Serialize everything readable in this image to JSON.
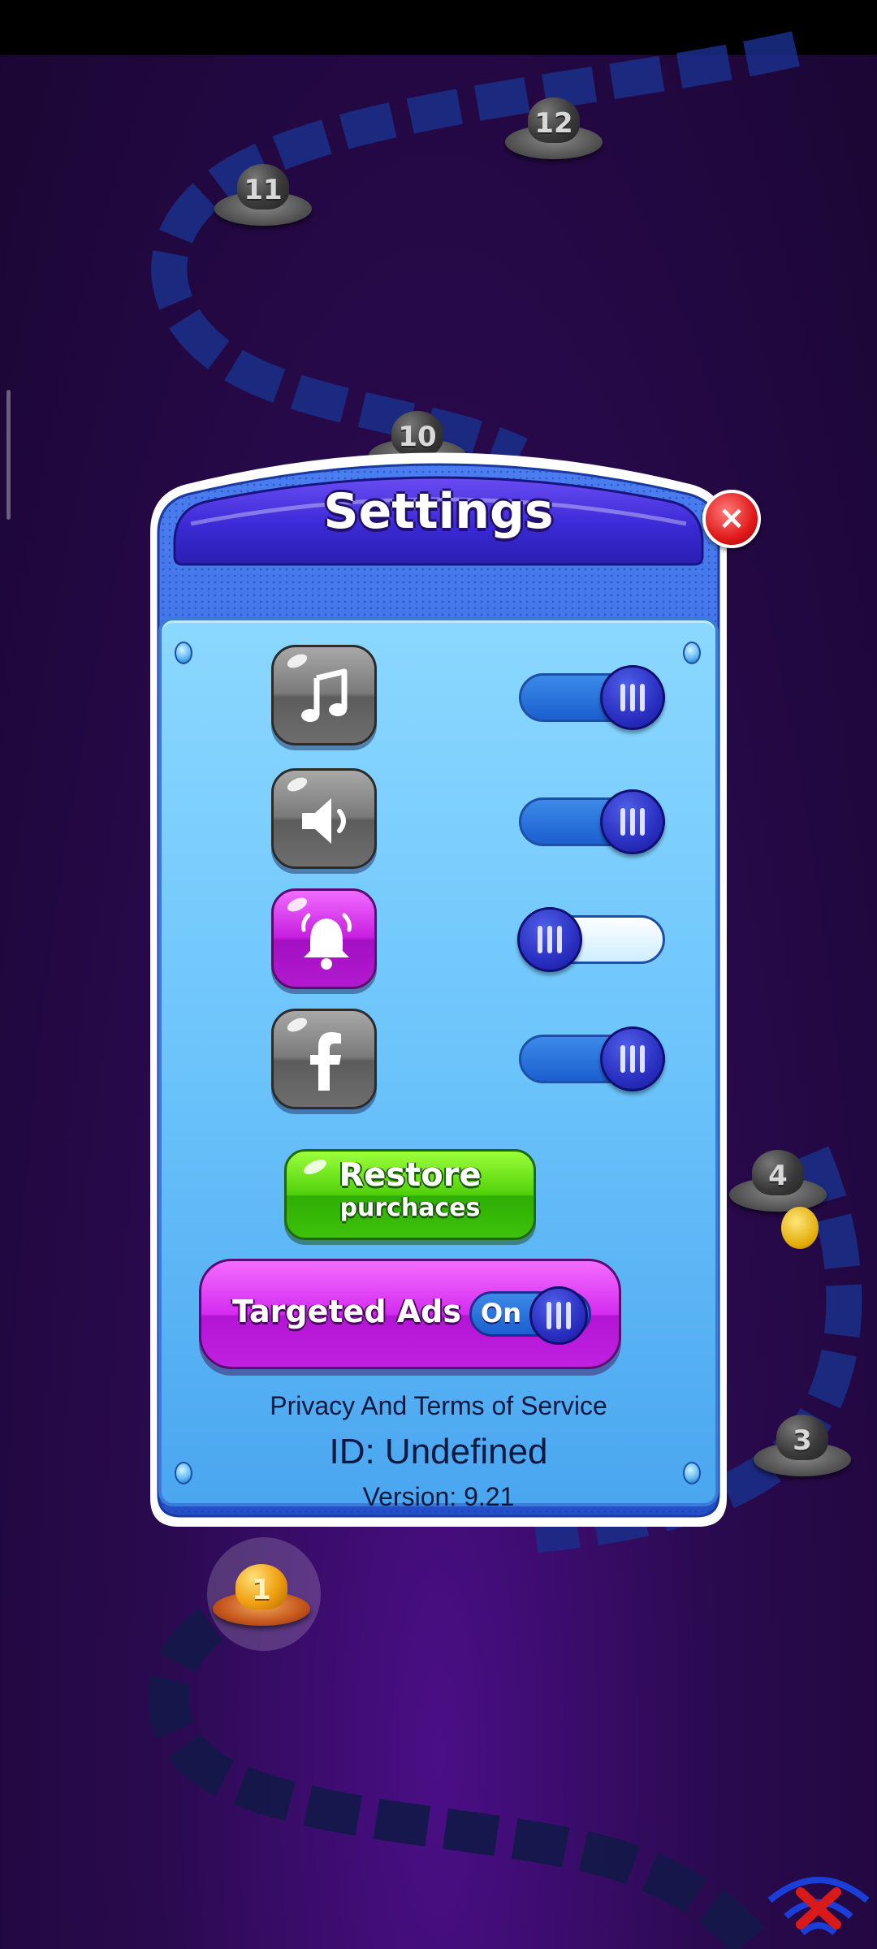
{
  "dialog": {
    "title": "Settings",
    "close_symbol": "×",
    "settings": [
      {
        "icon": "music-note-icon",
        "state": "on"
      },
      {
        "icon": "speaker-icon",
        "state": "on"
      },
      {
        "icon": "bell-icon",
        "state": "off"
      },
      {
        "icon": "facebook-icon",
        "state": "on"
      }
    ],
    "restore_button": {
      "line1": "Restore",
      "line2": "purchaces"
    },
    "targeted_ads": {
      "label": "Targeted Ads",
      "state": "On"
    },
    "privacy_link": "Privacy And  Terms of Service",
    "id_text": "ID: Undefined",
    "version_text": "Version: 9.21"
  },
  "map": {
    "levels": [
      "1",
      "3",
      "4",
      "10",
      "11",
      "12"
    ],
    "current_level": "1"
  },
  "colors": {
    "dialog_blue": "#2a5ed8",
    "panel_light_blue": "#7fd0ff",
    "toggle_knob": "#2a2fc0",
    "restore_green": "#50d10a",
    "ads_magenta": "#d42cf0",
    "close_red": "#e01a1a",
    "background_purple": "#2a0a4f"
  }
}
